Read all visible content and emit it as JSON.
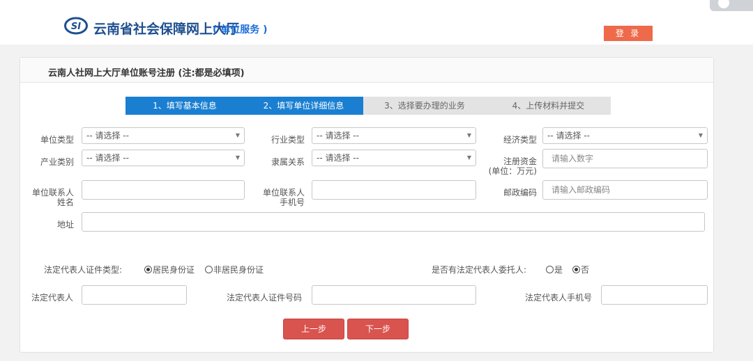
{
  "header": {
    "logo_text": "SI",
    "site_title": "云南省社会保障网上大厅",
    "site_subtitle": "( 单位服务 )",
    "login_label": "登 录"
  },
  "panel": {
    "title": "云南人社网上大厅单位账号注册 (注:都是必填项)"
  },
  "steps": [
    {
      "label": "1、填写基本信息",
      "active": true
    },
    {
      "label": "2、填写单位详细信息",
      "active": true
    },
    {
      "label": "3、选择要办理的业务",
      "active": false
    },
    {
      "label": "4、上传材料并提交",
      "active": false
    }
  ],
  "form": {
    "unit_type": {
      "label": "单位类型",
      "value": "-- 请选择 --"
    },
    "industry_type": {
      "label": "行业类型",
      "value": "-- 请选择 --"
    },
    "economic_type": {
      "label": "经济类型",
      "value": "-- 请选择 --"
    },
    "industry_category": {
      "label": "产业类别",
      "value": "-- 请选择 --"
    },
    "affiliation": {
      "label": "隶属关系",
      "value": "-- 请选择 --"
    },
    "registered_capital": {
      "label_1": "注册资金",
      "label_2": "(单位：万元)",
      "placeholder": "请输入数字"
    },
    "contact_name": {
      "label_1": "单位联系人",
      "label_2": "姓名",
      "value": ""
    },
    "contact_phone": {
      "label_1": "单位联系人",
      "label_2": "手机号",
      "value": ""
    },
    "postal_code": {
      "label": "邮政编码",
      "placeholder": "请输入邮政编码"
    },
    "address": {
      "label": "地址",
      "value": ""
    },
    "legal_id_type": {
      "label": "法定代表人证件类型:",
      "options": [
        {
          "label": "居民身份证",
          "checked": true
        },
        {
          "label": "非居民身份证",
          "checked": false
        }
      ]
    },
    "has_delegate": {
      "label": "是否有法定代表人委托人:",
      "options": [
        {
          "label": "是",
          "checked": false
        },
        {
          "label": "否",
          "checked": true
        }
      ]
    },
    "legal_rep": {
      "label": "法定代表人",
      "value": ""
    },
    "legal_rep_id": {
      "label": "法定代表人证件号码",
      "value": ""
    },
    "legal_rep_phone": {
      "label": "法定代表人手机号",
      "value": ""
    }
  },
  "buttons": {
    "prev": "上一步",
    "next": "下一步"
  },
  "colors": {
    "brand_blue": "#1e4f8f",
    "step_active": "#1a7fd1",
    "step_todo": "#e3e3e3",
    "login": "#ee6a4a",
    "action": "#d9534f"
  }
}
